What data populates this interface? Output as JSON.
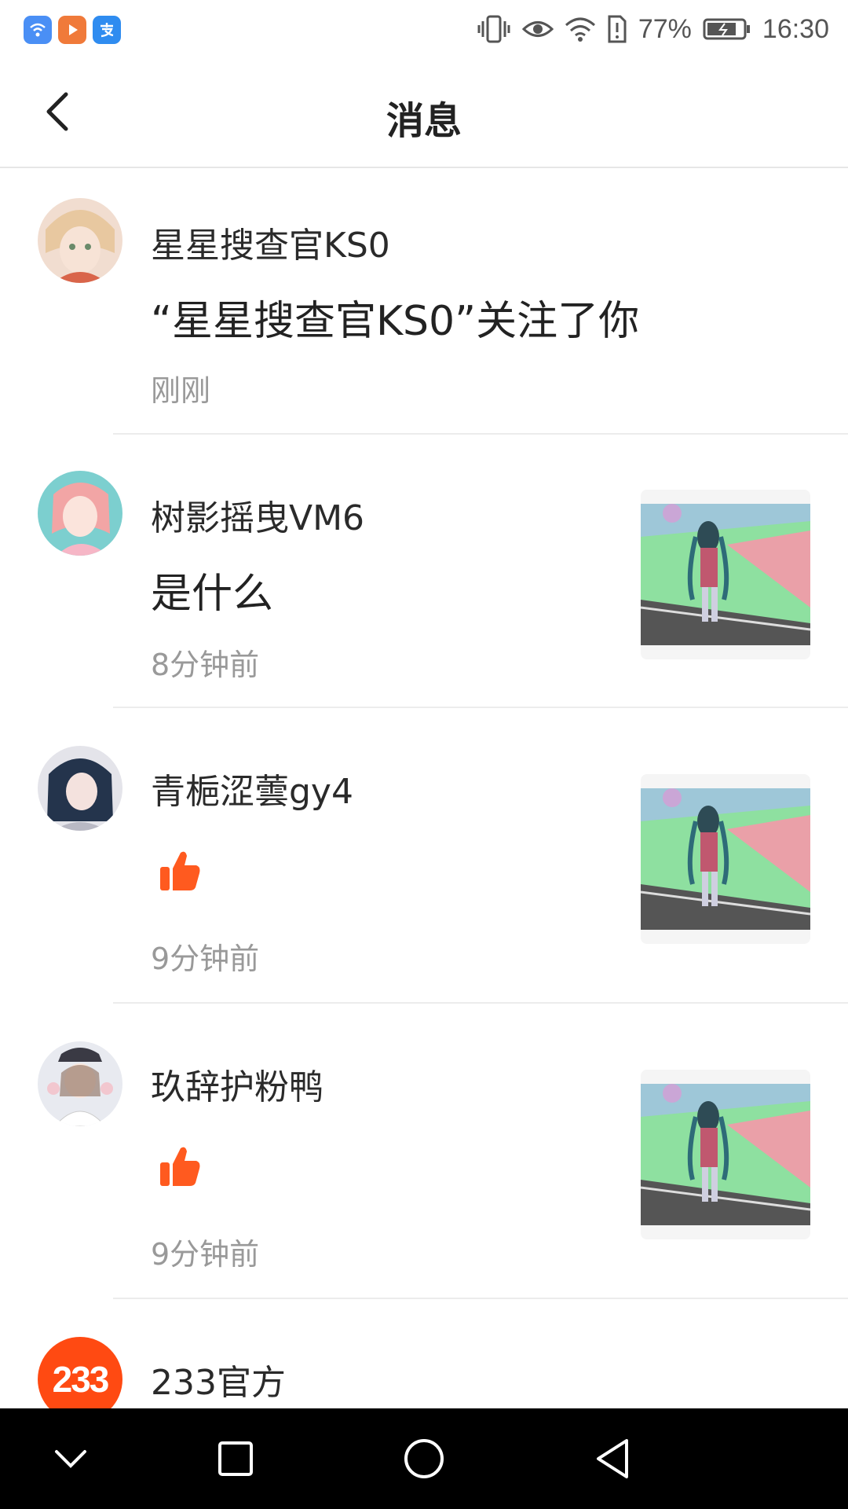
{
  "status_bar": {
    "apps": [
      {
        "icon": "wifi-app-icon",
        "color": "#4a8ff5"
      },
      {
        "icon": "video-app-icon",
        "color": "#f07a3a"
      },
      {
        "icon": "alipay-icon",
        "color": "#2f8cf0"
      }
    ],
    "battery": "77%",
    "time": "16:30"
  },
  "header": {
    "title": "消息",
    "back_icon": "back-arrow-icon"
  },
  "messages": [
    {
      "name": "星星搜查官KS0",
      "content": "“星星搜查官KS0”关注了你",
      "time": "刚刚",
      "type": "follow"
    },
    {
      "name": "树影摇曳VM6",
      "content": "是什么",
      "time": "8分钟前",
      "type": "comment"
    },
    {
      "name": "青梔涩蕓gy4",
      "content": "",
      "time": "9分钟前",
      "type": "like"
    },
    {
      "name": "玖辞护粉鸭",
      "content": "",
      "time": "9分钟前",
      "type": "like"
    },
    {
      "name": "233官方",
      "avatar_text": "233",
      "type": "official"
    }
  ],
  "colors": {
    "like": "#ff5a1f",
    "official_avatar": "#ff4a12",
    "time_gray": "#999999"
  },
  "nav": {
    "icons": [
      "chevron-down-icon",
      "recents-square-icon",
      "home-circle-icon",
      "back-triangle-icon"
    ]
  }
}
